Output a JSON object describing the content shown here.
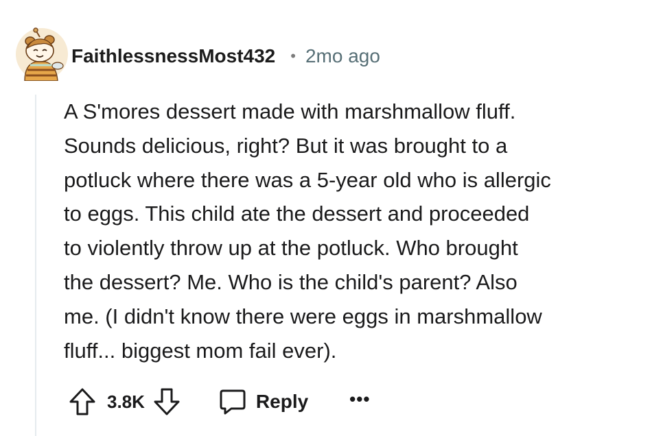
{
  "comment": {
    "username": "FaithlessnessMost432",
    "separator": "•",
    "timestamp": "2mo ago",
    "body_lines": [
      "A S'mores dessert made with marshmallow fluff.",
      "Sounds delicious, right? But it was brought to a",
      "potluck where there was a 5-year old who is allergic",
      "to eggs. This child ate the dessert and proceeded",
      "to violently throw up at the potluck. Who brought",
      "the dessert? Me. Who is the child's parent? Also",
      "me. (I didn't know there were eggs in marshmallow",
      "fluff... biggest mom fail ever)."
    ]
  },
  "actions": {
    "upvote_icon": "upvote-arrow-icon",
    "vote_count": "3.8K",
    "downvote_icon": "downvote-arrow-icon",
    "reply_icon": "speech-bubble-icon",
    "reply_label": "Reply",
    "more_label": "•••"
  },
  "colors": {
    "text": "#1a1a1b",
    "meta": "#576f76",
    "thread_line": "#e5ebee",
    "avatar_bg": "#f6e6c9"
  }
}
